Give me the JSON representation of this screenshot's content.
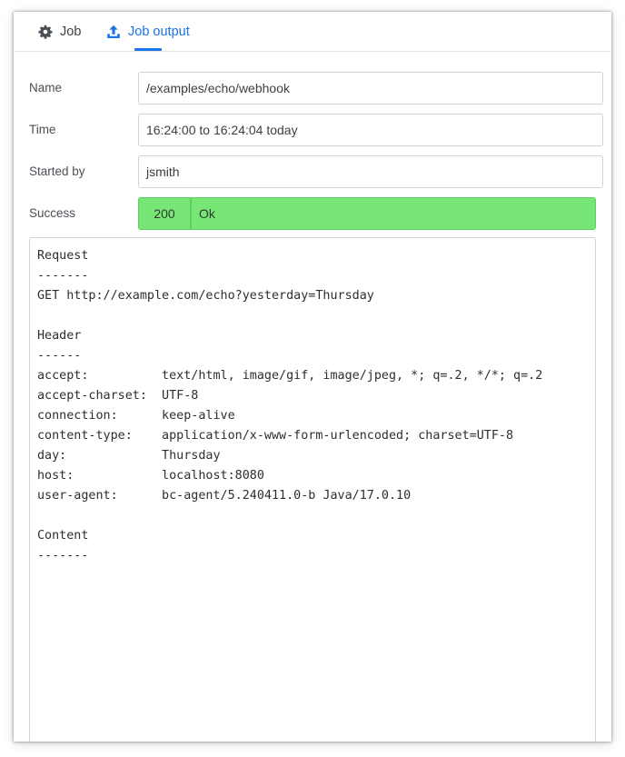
{
  "tabs": [
    {
      "label": "Job",
      "icon": "gear-icon",
      "active": false
    },
    {
      "label": "Job output",
      "icon": "upload-icon",
      "active": true
    }
  ],
  "fields": {
    "name": {
      "label": "Name",
      "value": "/examples/echo/webhook"
    },
    "time": {
      "label": "Time",
      "value": "16:24:00 to 16:24:04 today"
    },
    "started_by": {
      "label": "Started by",
      "value": "jsmith"
    },
    "success": {
      "label": "Success",
      "code": "200",
      "text": "Ok"
    }
  },
  "output": {
    "text": "Request\n-------\nGET http://example.com/echo?yesterday=Thursday\n\nHeader\n------\naccept:          text/html, image/gif, image/jpeg, *; q=.2, */*; q=.2\naccept-charset:  UTF-8\nconnection:      keep-alive\ncontent-type:    application/x-www-form-urlencoded; charset=UTF-8\nday:             Thursday\nhost:            localhost:8080\nuser-agent:      bc-agent/5.240411.0-b Java/17.0.10\n\nContent\n-------"
  },
  "colors": {
    "accent": "#1a73e8",
    "success_bg": "#77e677"
  }
}
